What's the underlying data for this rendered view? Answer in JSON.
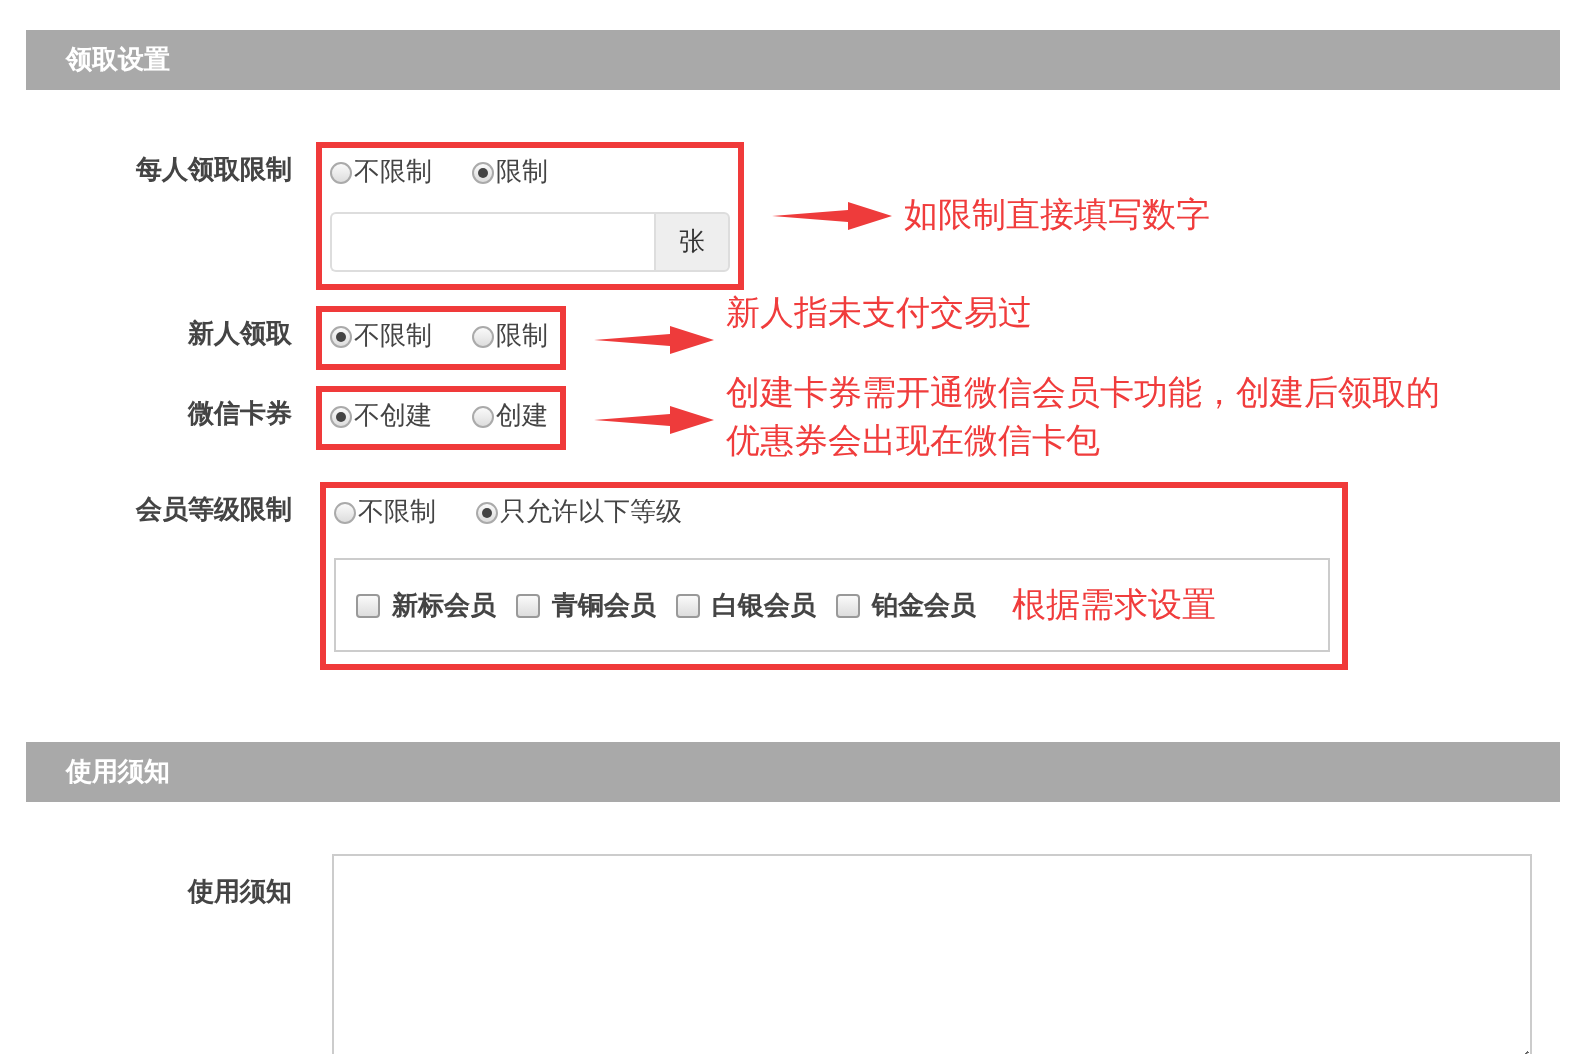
{
  "sections": [
    {
      "title": "领取设置",
      "fields": [
        {
          "label": "每人领取限制",
          "kind": "radio-input",
          "options": [
            {
              "label": "不限制",
              "selected": false
            },
            {
              "label": "限制",
              "selected": true
            }
          ],
          "input": {
            "addon": "张"
          },
          "note": "如限制直接填写数字"
        },
        {
          "label": "新人领取",
          "kind": "radio",
          "options": [
            {
              "label": "不限制",
              "selected": true
            },
            {
              "label": "限制",
              "selected": false
            }
          ],
          "note": "新人指未支付交易过"
        },
        {
          "label": "微信卡券",
          "kind": "radio",
          "options": [
            {
              "label": "不创建",
              "selected": true
            },
            {
              "label": "创建",
              "selected": false
            }
          ],
          "note": "创建卡券需开通微信会员卡功能，创建后领取的优惠券会出现在微信卡包"
        },
        {
          "label": "会员等级限制",
          "kind": "radio-levels",
          "options": [
            {
              "label": "不限制",
              "selected": false
            },
            {
              "label": "只允许以下等级",
              "selected": true
            }
          ],
          "levels": [
            {
              "label": "新标会员",
              "checked": false
            },
            {
              "label": "青铜会员",
              "checked": false
            },
            {
              "label": "白银会员",
              "checked": false
            },
            {
              "label": "铂金会员",
              "checked": false
            }
          ],
          "note": "根据需求设置"
        }
      ]
    },
    {
      "title": "使用须知",
      "fields": [
        {
          "label": "使用须知",
          "kind": "textarea"
        }
      ]
    }
  ]
}
